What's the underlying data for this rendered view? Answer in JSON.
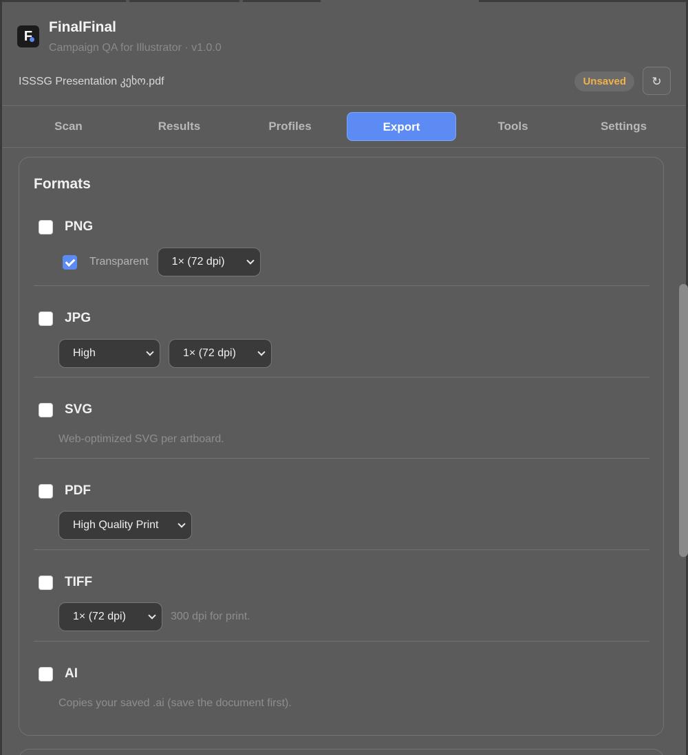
{
  "app": {
    "title": "FinalFinal",
    "subtitle": "Campaign QA for Illustrator · v1.0.0",
    "logo_letter": "F",
    "accent_color": "#5b8bf3"
  },
  "document": {
    "name": "ISSSG Presentation კეხო.pdf",
    "status_badge": "Unsaved",
    "status_color": "#f0b24a",
    "refresh_icon": "↻"
  },
  "tabs": [
    {
      "label": "Scan",
      "active": false
    },
    {
      "label": "Results",
      "active": false
    },
    {
      "label": "Profiles",
      "active": false
    },
    {
      "label": "Export",
      "active": true
    },
    {
      "label": "Tools",
      "active": false
    },
    {
      "label": "Settings",
      "active": false
    }
  ],
  "formats": {
    "title": "Formats",
    "png": {
      "label": "PNG",
      "checked": false,
      "transparent_label": "Transparent",
      "transparent_checked": true,
      "scale": "1× (72 dpi)"
    },
    "jpg": {
      "label": "JPG",
      "checked": false,
      "quality": "High",
      "scale": "1× (72 dpi)"
    },
    "svg": {
      "label": "SVG",
      "checked": false,
      "hint": "Web-optimized SVG per artboard."
    },
    "pdf": {
      "label": "PDF",
      "checked": false,
      "preset": "High Quality Print"
    },
    "tiff": {
      "label": "TIFF",
      "checked": false,
      "scale": "1× (72 dpi)",
      "hint": "300 dpi for print."
    },
    "ai": {
      "label": "AI",
      "checked": false,
      "hint": "Copies your saved .ai (save the document first)."
    }
  }
}
